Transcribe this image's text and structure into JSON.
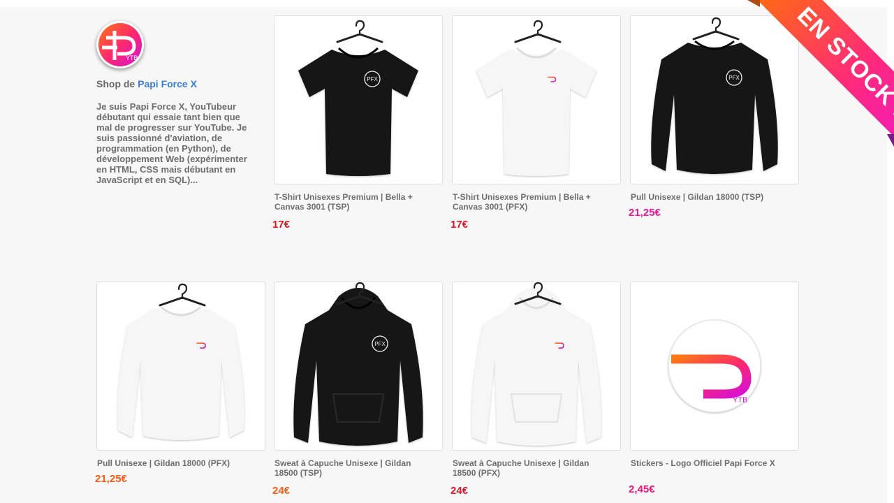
{
  "shop": {
    "prefix": "Shop de ",
    "name": "Papi Force X",
    "logo_text": "YTB",
    "bio": "Je suis Papi Force X, YouTubeur débutant qui essaie tant bien que mal de progresser sur YouTube. Je suis passionné d'aviation, de programmation (en Python), de développement Web (expérimenter en HTML, CSS mais débutant en JavaScript et en SQL)..."
  },
  "ribbon": {
    "label": "EN STOCK !"
  },
  "products": [
    {
      "name": "T-Shirt Unisexes Premium | Bella + Canvas 3001 (TSP)",
      "price": "17€",
      "price_color": "#e0141e",
      "garment": "tshirt",
      "color": "black",
      "print": "PFX"
    },
    {
      "name": "T-Shirt Unisexes Premium | Bella + Canvas 3001 (PFX)",
      "price": "17€",
      "price_color": "#e0142e",
      "garment": "tshirt",
      "color": "white",
      "print": "logo"
    },
    {
      "name": "Pull Unisexe | Gildan 18000 (TSP)",
      "price": "21,25€",
      "price_color": "#f0149a",
      "garment": "sweatshirt",
      "color": "black",
      "print": "PFX"
    },
    {
      "name": "Pull Unisexe | Gildan 18000 (PFX)",
      "price": "21,25€",
      "price_color": "#ff5a14",
      "garment": "sweatshirt",
      "color": "white",
      "print": "logo"
    },
    {
      "name": "Sweat à Capuche Unisexe | Gildan 18500 (TSP)",
      "price": "24€",
      "price_color": "#ff5a14",
      "garment": "hoodie",
      "color": "black",
      "print": "PFX"
    },
    {
      "name": "Sweat à Capuche Unisexe | Gildan 18500 (PFX)",
      "price": "24€",
      "price_color": "#e0142a",
      "garment": "hoodie",
      "color": "white",
      "print": "logo"
    },
    {
      "name": "Stickers - Logo Officiel Papi Force X",
      "price": "2,45€",
      "price_color": "#f01478",
      "garment": "sticker",
      "color": "white",
      "print": "logo"
    }
  ]
}
